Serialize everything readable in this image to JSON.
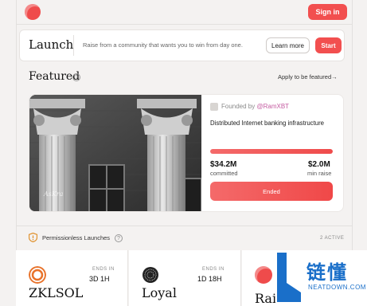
{
  "header": {
    "signin_label": "Sign in"
  },
  "launch": {
    "title": "Launch",
    "description": "Raise from a community that wants you to win from day one.",
    "learn_more_label": "Learn more",
    "start_label": "Start"
  },
  "featured": {
    "title": "Featured",
    "apply_label": "Apply to be featured→",
    "founded_prefix": "Founded by",
    "founder_handle": "@RamXBT",
    "description": "Distributed Internet banking infrastructure",
    "progress": 1.0,
    "committed_value": "$34.2M",
    "committed_label": "committed",
    "min_raise_value": "$2.0M",
    "min_raise_label": "min raise",
    "status_label": "Ended",
    "image_overlay_text": "AsKra"
  },
  "permissionless": {
    "title": "Permissionless Launches",
    "active_count": "2 ACTIVE",
    "tokens": [
      {
        "name": "ZKLSOL",
        "ends_label": "ENDS IN",
        "ends_value": "3D 1H",
        "icon": "zklsol-logo-icon",
        "color": "#e8722a"
      },
      {
        "name": "Loyal",
        "ends_label": "ENDS IN",
        "ends_value": "1D 18H",
        "icon": "loyal-logo-icon",
        "color": "#222222"
      },
      {
        "name": "Rai",
        "ends_label": "",
        "ends_value": "",
        "icon": "rai-logo-icon",
        "color": "#ef4b4b"
      }
    ]
  },
  "watermark": {
    "cn_text": "链懂",
    "url": "NEATDOWN.COM"
  },
  "colors": {
    "accent": "#f24f4f",
    "background": "#f4f2f1"
  }
}
